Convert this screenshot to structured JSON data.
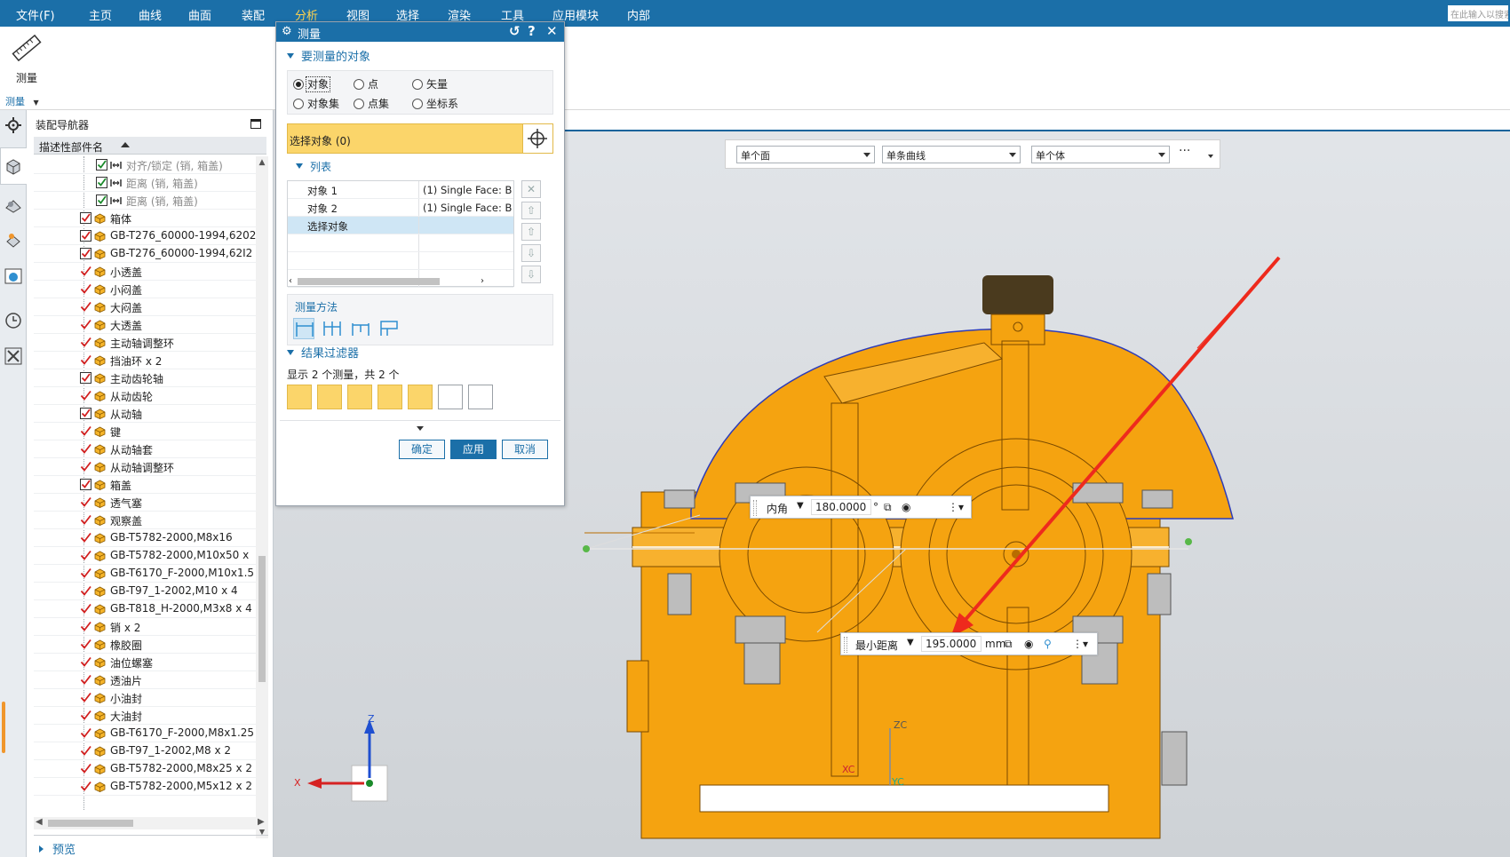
{
  "menu": {
    "items": [
      "文件(F)",
      "主页",
      "曲线",
      "曲面",
      "装配",
      "分析",
      "视图",
      "选择",
      "渲染",
      "工具",
      "应用模块",
      "内部"
    ],
    "active": "分析",
    "search_placeholder": "在此输入以搜索"
  },
  "ribbon": {
    "tool_label": "测量",
    "group_label": "测量"
  },
  "navigator": {
    "title": "装配导航器",
    "column_header": "描述性部件名",
    "rows": [
      {
        "label": "对齐/锁定 (销, 箱盖)",
        "state": "constraint",
        "grey": true
      },
      {
        "label": "距离 (销, 箱盖)",
        "state": "constraint",
        "grey": true
      },
      {
        "label": "距离 (销, 箱盖)",
        "state": "constraint",
        "grey": true
      },
      {
        "label": "箱体",
        "state": "box"
      },
      {
        "label": "GB-T276_60000-1994,6202",
        "state": "box"
      },
      {
        "label": "GB-T276_60000-1994,62I2",
        "state": "box"
      },
      {
        "label": "小透盖",
        "state": "tick"
      },
      {
        "label": "小闷盖",
        "state": "tick"
      },
      {
        "label": "大闷盖",
        "state": "tick"
      },
      {
        "label": "大透盖",
        "state": "tick"
      },
      {
        "label": "主动轴调整环",
        "state": "tick"
      },
      {
        "label": "挡油环 x 2",
        "state": "tick"
      },
      {
        "label": "主动齿轮轴",
        "state": "box"
      },
      {
        "label": "从动齿轮",
        "state": "tick"
      },
      {
        "label": "从动轴",
        "state": "box"
      },
      {
        "label": "键",
        "state": "tick"
      },
      {
        "label": "从动轴套",
        "state": "tick"
      },
      {
        "label": "从动轴调整环",
        "state": "tick"
      },
      {
        "label": "箱盖",
        "state": "box"
      },
      {
        "label": "透气塞",
        "state": "tick"
      },
      {
        "label": "观察盖",
        "state": "tick"
      },
      {
        "label": "GB-T5782-2000,M8x16",
        "state": "tick"
      },
      {
        "label": "GB-T5782-2000,M10x50 x",
        "state": "tick"
      },
      {
        "label": "GB-T6170_F-2000,M10x1.5",
        "state": "tick"
      },
      {
        "label": "GB-T97_1-2002,M10 x 4",
        "state": "tick"
      },
      {
        "label": "GB-T818_H-2000,M3x8 x 4",
        "state": "tick"
      },
      {
        "label": "销 x 2",
        "state": "tick"
      },
      {
        "label": "橡胶圈",
        "state": "tick"
      },
      {
        "label": "油位螺塞",
        "state": "tick"
      },
      {
        "label": "透油片",
        "state": "tick"
      },
      {
        "label": "小油封",
        "state": "tick"
      },
      {
        "label": "大油封",
        "state": "tick"
      },
      {
        "label": "GB-T6170_F-2000,M8x1.25",
        "state": "tick"
      },
      {
        "label": "GB-T97_1-2002,M8 x 2",
        "state": "tick"
      },
      {
        "label": "GB-T5782-2000,M8x25 x 2",
        "state": "tick"
      },
      {
        "label": "GB-T5782-2000,M5x12 x 2",
        "state": "tick"
      }
    ],
    "preview_label": "预览"
  },
  "filterbar": {
    "combo1": "单个面",
    "combo2": "单条曲线",
    "combo3": "单个体",
    "more": "···"
  },
  "dialog": {
    "title": "测量",
    "section_objects": "要测量的对象",
    "radios": [
      {
        "label": "对象",
        "checked": true
      },
      {
        "label": "点",
        "checked": false
      },
      {
        "label": "矢量",
        "checked": false
      },
      {
        "label": "对象集",
        "checked": false
      },
      {
        "label": "点集",
        "checked": false
      },
      {
        "label": "坐标系",
        "checked": false
      }
    ],
    "select_label": "选择对象 (0)",
    "section_list": "列表",
    "list_rows": [
      {
        "name": "对象 1",
        "value": "(1) Single Face: B"
      },
      {
        "name": "对象 2",
        "value": "(1) Single Face: B"
      },
      {
        "name": "选择对象",
        "value": ""
      }
    ],
    "method_label": "测量方法",
    "section_filter": "结果过滤器",
    "filter_status": "显示 2 个测量，共 2 个",
    "btn_ok": "确定",
    "btn_apply": "应用",
    "btn_cancel": "取消"
  },
  "callouts": {
    "angle": {
      "label": "内角",
      "value": "180.0000",
      "unit": "°"
    },
    "distance": {
      "label": "最小距离",
      "value": "195.0000",
      "unit": "mm"
    }
  },
  "axes": {
    "z": "Z",
    "x": "X",
    "zc": "ZC",
    "xc": "XC",
    "yc": "YC"
  },
  "colors": {
    "menu_bg": "#1b6fa8",
    "part_orange": "#f5a310",
    "select_yellow": "#fbd56a",
    "arrow_red": "#ee2a1d"
  }
}
